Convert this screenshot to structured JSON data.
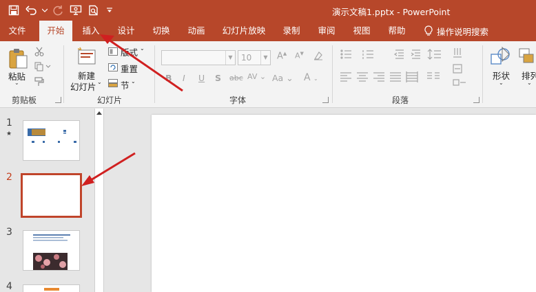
{
  "window": {
    "title": "演示文稿1.pptx  -  PowerPoint",
    "brand_color": "#b7472a"
  },
  "quick_access": [
    "save-icon",
    "undo-icon",
    "redo-icon",
    "present-from-start-icon",
    "print-preview-icon",
    "customize-qat-icon"
  ],
  "menu_tabs": [
    {
      "label": "文件"
    },
    {
      "label": "开始"
    },
    {
      "label": "插入"
    },
    {
      "label": "设计"
    },
    {
      "label": "切换"
    },
    {
      "label": "动画"
    },
    {
      "label": "幻灯片放映"
    },
    {
      "label": "录制"
    },
    {
      "label": "审阅"
    },
    {
      "label": "视图"
    },
    {
      "label": "帮助"
    }
  ],
  "active_tab": "开始",
  "tell_me": "操作说明搜索",
  "ribbon": {
    "clipboard": {
      "paste_label": "粘贴",
      "group_label": "剪贴板"
    },
    "slides": {
      "new_slide_line1": "新建",
      "new_slide_line2": "幻灯片",
      "layout_label": "版式",
      "reset_label": "重置",
      "section_label": "节",
      "group_label": "幻灯片"
    },
    "font": {
      "font_name_value": "",
      "font_size_value": "10",
      "bold": "B",
      "italic": "I",
      "underline": "U",
      "shadow": "S",
      "strike": "abc",
      "spacing": "AV",
      "case": "Aa",
      "color": "A",
      "grow": "A",
      "shrink": "A",
      "group_label": "字体"
    },
    "paragraph": {
      "group_label": "段落"
    },
    "drawing": {
      "shapes_label": "形状",
      "arrange_label": "排列"
    }
  },
  "slides_panel": {
    "slides": [
      {
        "number": "1",
        "has_transition_star": true
      },
      {
        "number": "2",
        "selected": true
      },
      {
        "number": "3"
      },
      {
        "number": "4"
      }
    ]
  },
  "annotations": {
    "arrow_color": "#d02020"
  }
}
